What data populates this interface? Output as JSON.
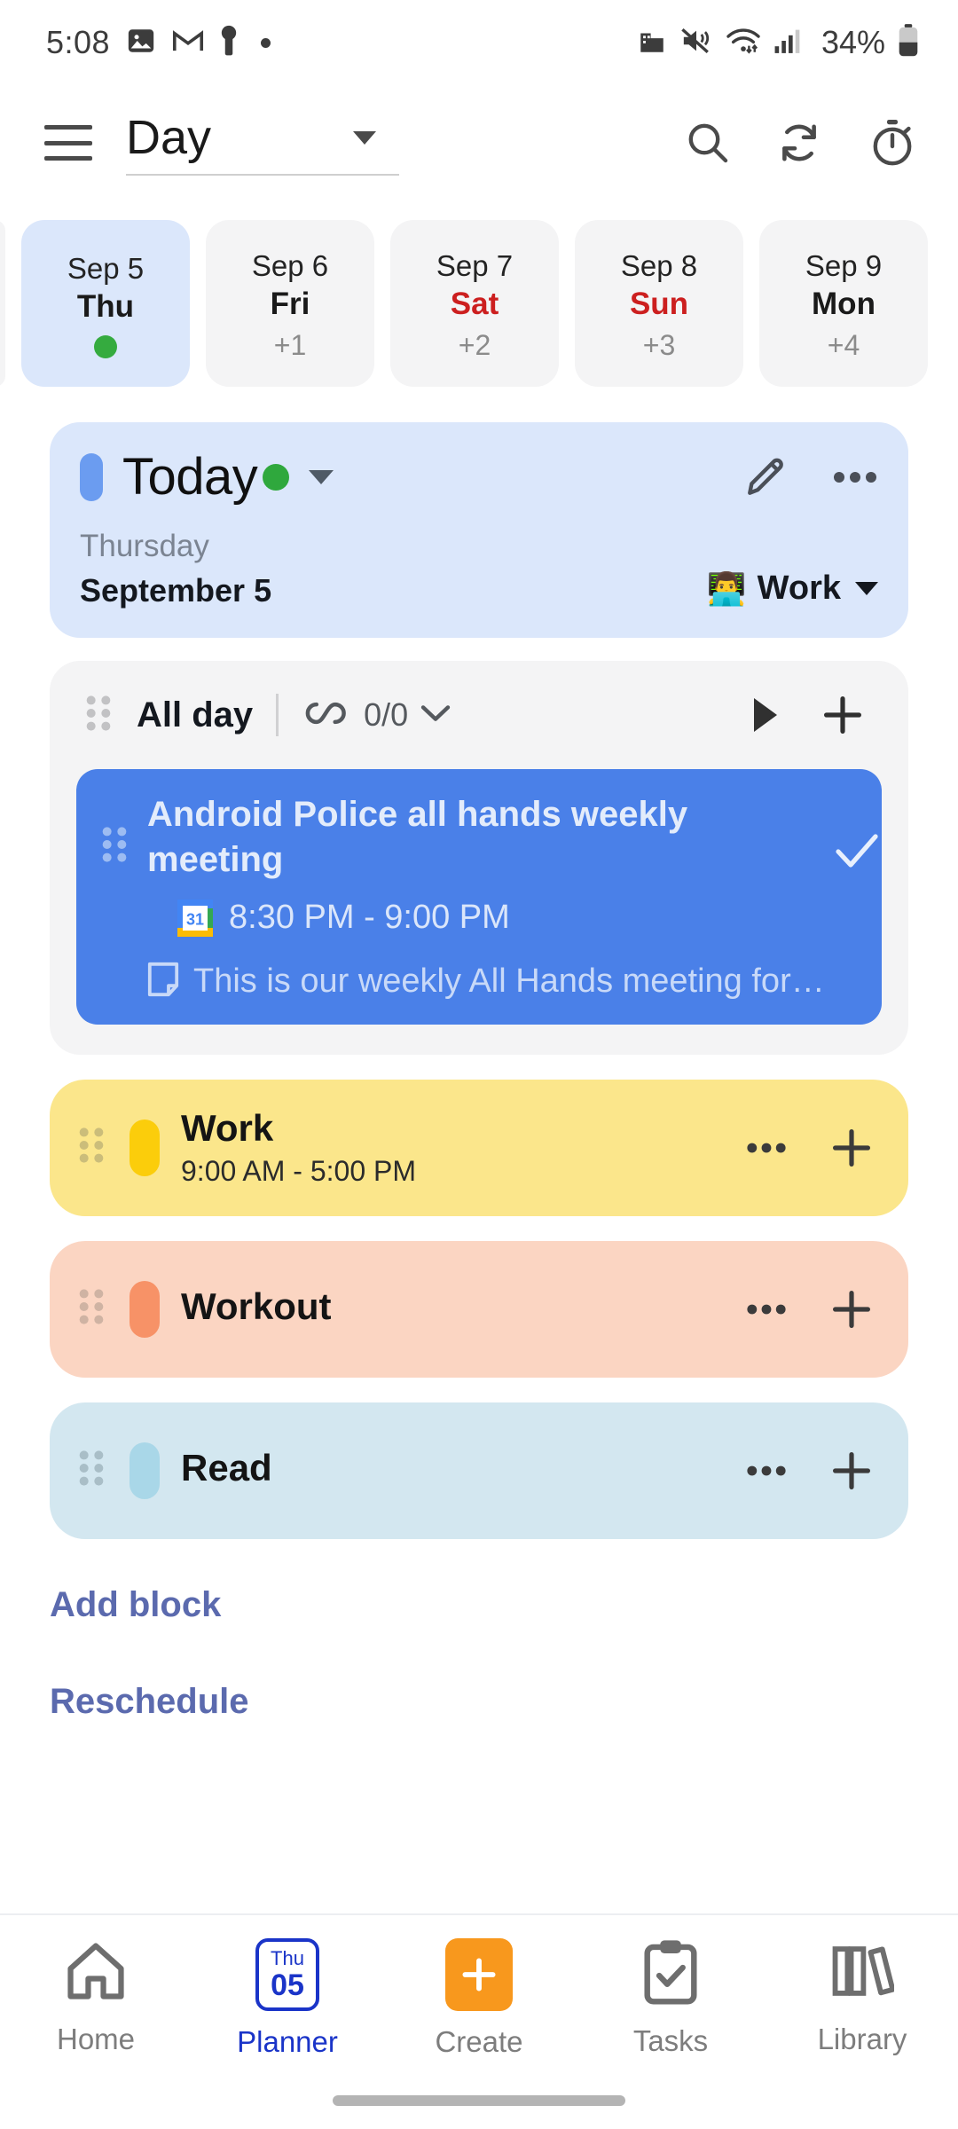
{
  "status_bar": {
    "time": "5:08",
    "left_icons": [
      "photos-icon",
      "gmail-icon",
      "key-icon",
      "dot-icon"
    ],
    "right_icons": [
      "work-profile-icon",
      "vibrate-off-icon",
      "wifi-icon",
      "cell-signal-icon"
    ],
    "battery_percent": "34%"
  },
  "app_bar": {
    "menu_icon": "hamburger-menu-icon",
    "view_label": "Day",
    "actions": [
      {
        "name": "search-icon",
        "label": "Search"
      },
      {
        "name": "refresh-icon",
        "label": "Refresh"
      },
      {
        "name": "timer-icon",
        "label": "Timer"
      }
    ]
  },
  "date_strip": [
    {
      "month_day": "Sep 5",
      "dow": "Thu",
      "offset": "",
      "selected": true,
      "weekend": false,
      "has_dot": true
    },
    {
      "month_day": "Sep 6",
      "dow": "Fri",
      "offset": "+1",
      "selected": false,
      "weekend": false,
      "has_dot": false
    },
    {
      "month_day": "Sep 7",
      "dow": "Sat",
      "offset": "+2",
      "selected": false,
      "weekend": true,
      "has_dot": false
    },
    {
      "month_day": "Sep 8",
      "dow": "Sun",
      "offset": "+3",
      "selected": false,
      "weekend": true,
      "has_dot": false
    },
    {
      "month_day": "Sep 9",
      "dow": "Mon",
      "offset": "+4",
      "selected": false,
      "weekend": false,
      "has_dot": false
    }
  ],
  "today_card": {
    "title": "Today",
    "day_name": "Thursday",
    "date": "September 5",
    "context_emoji": "👨‍💻",
    "context_label": "Work",
    "edit_icon": "pencil-icon",
    "more_icon": "more-options-icon"
  },
  "all_day": {
    "label": "All day",
    "loop_icon": "infinity-loop-icon",
    "count": "0/0",
    "play_icon": "play-icon",
    "add_icon": "plus-icon",
    "event": {
      "title": "Android Police all hands weekly meeting",
      "calendar_icon": "google-calendar-icon",
      "time": "8:30 PM - 9:00 PM",
      "note_icon": "note-icon",
      "description": "This is our weekly All Hands meeting for…",
      "check_icon": "check-icon"
    }
  },
  "blocks": [
    {
      "name": "Work",
      "time": "9:00 AM - 5:00 PM",
      "color_class": "work",
      "accent": "#fbcd0b",
      "bg": "#fbe68b"
    },
    {
      "name": "Workout",
      "time": "",
      "color_class": "workout",
      "accent": "#f79267",
      "bg": "#fbd5c2"
    },
    {
      "name": "Read",
      "time": "",
      "color_class": "read",
      "accent": "#a9d7e8",
      "bg": "#d3e7f0"
    }
  ],
  "links": {
    "add_block": "Add block",
    "reschedule": "Reschedule"
  },
  "bottom_nav": [
    {
      "label": "Home",
      "icon": "home-icon",
      "active": false
    },
    {
      "label": "Planner",
      "icon": "calendar-icon",
      "active": true,
      "cal_dow": "Thu",
      "cal_day": "05"
    },
    {
      "label": "Create",
      "icon": "plus-square-icon",
      "active": false
    },
    {
      "label": "Tasks",
      "icon": "clipboard-check-icon",
      "active": false
    },
    {
      "label": "Library",
      "icon": "books-icon",
      "active": false
    }
  ],
  "colors": {
    "accent_blue": "#4a80e8",
    "selected_chip": "#dbe7fb",
    "today_card_bg": "#dbe7fb",
    "green_dot": "#35ab3f",
    "weekend_red": "#cc1f1f",
    "link_purple": "#5b6aae",
    "nav_active": "#1a34c8",
    "create_orange": "#f8981d"
  }
}
